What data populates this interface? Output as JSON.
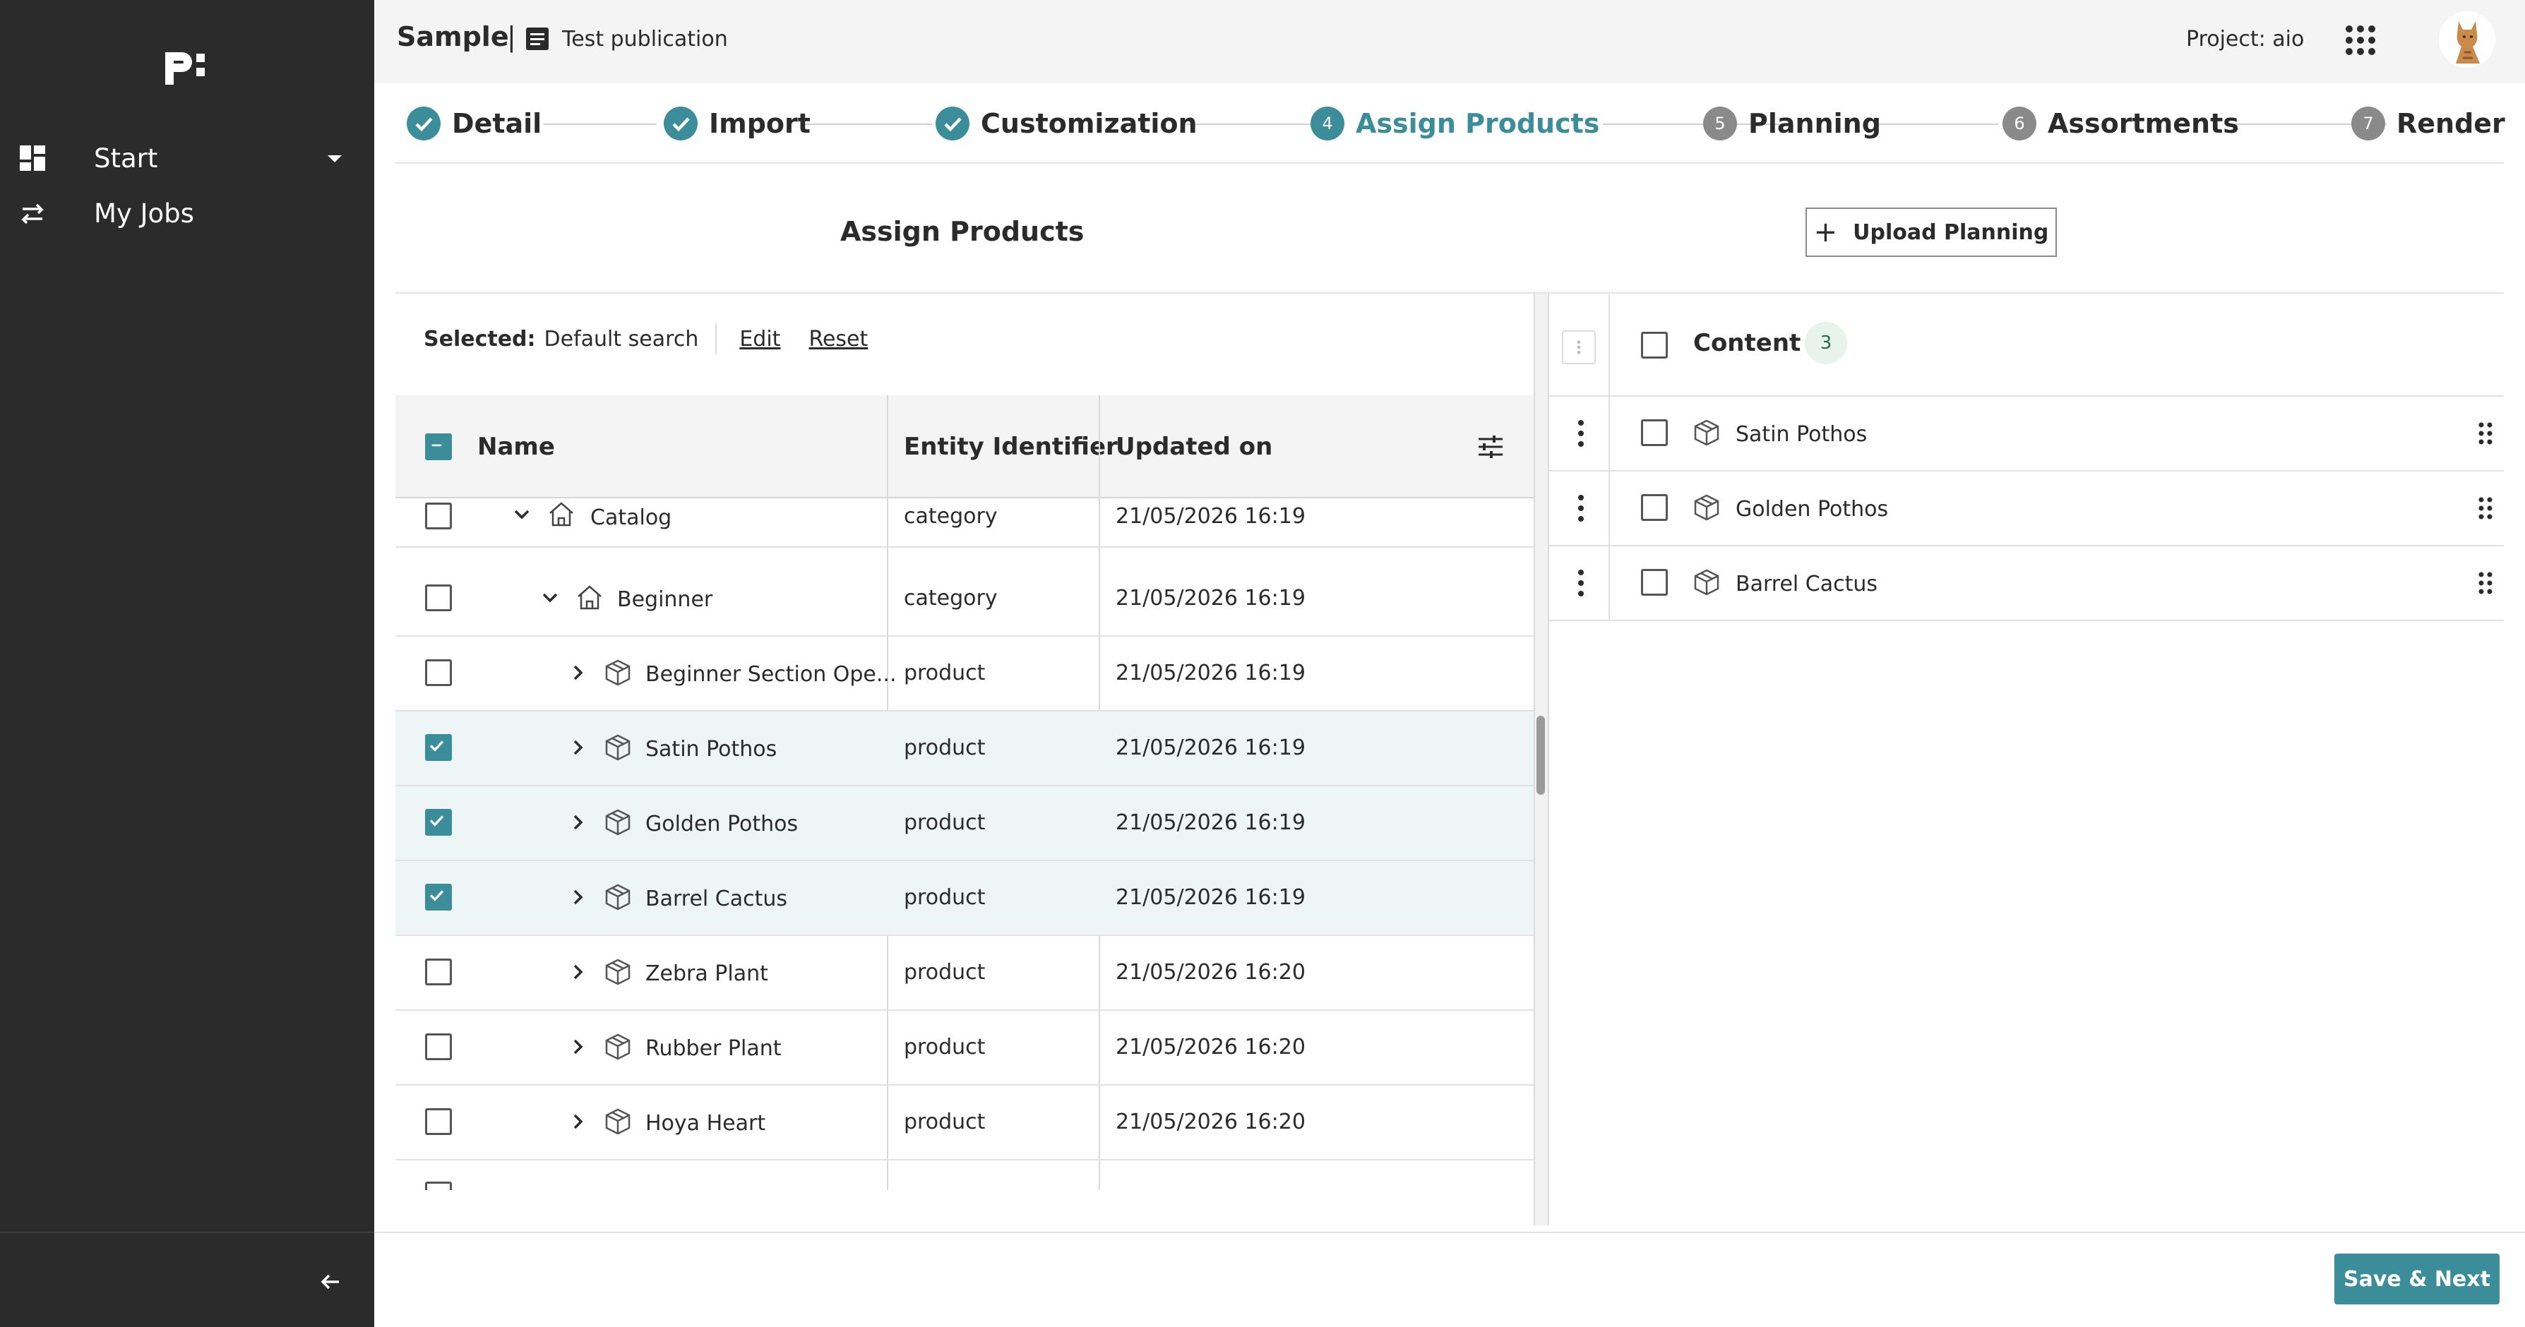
{
  "sidebar": {
    "logo_text": "p:",
    "items": [
      {
        "label": "Start",
        "icon": "dashboard-icon"
      },
      {
        "label": "My Jobs",
        "icon": "swap-icon"
      }
    ]
  },
  "header": {
    "title": "Sample",
    "separator": "|",
    "publication": "Test publication",
    "project": "Project: aio"
  },
  "stepper": {
    "steps": [
      {
        "label": "Detail",
        "state": "done"
      },
      {
        "label": "Import",
        "state": "done"
      },
      {
        "label": "Customization",
        "state": "done"
      },
      {
        "label": "Assign Products",
        "state": "active",
        "number": "4"
      },
      {
        "label": "Planning",
        "state": "todo",
        "number": "5"
      },
      {
        "label": "Assortments",
        "state": "todo",
        "number": "6"
      },
      {
        "label": "Render",
        "state": "todo",
        "number": "7"
      }
    ]
  },
  "section": {
    "title": "Assign Products",
    "upload_label": "Upload Planning"
  },
  "selection": {
    "key": "Selected:",
    "value": "Default search",
    "edit": "Edit",
    "reset": "Reset"
  },
  "table": {
    "columns": [
      "Name",
      "Entity Identifier",
      "Updated on"
    ],
    "rows": [
      {
        "name": "Catalog",
        "type": "category",
        "updated": "21/05/2026 16:19",
        "checked": false
      },
      {
        "name": "Beginner",
        "type": "category",
        "updated": "21/05/2026 16:19",
        "checked": false
      },
      {
        "name": "Beginner Section Ope...",
        "type": "product",
        "updated": "21/05/2026 16:19",
        "checked": false
      },
      {
        "name": "Satin Pothos",
        "type": "product",
        "updated": "21/05/2026 16:19",
        "checked": true
      },
      {
        "name": "Golden Pothos",
        "type": "product",
        "updated": "21/05/2026 16:19",
        "checked": true
      },
      {
        "name": "Barrel Cactus",
        "type": "product",
        "updated": "21/05/2026 16:19",
        "checked": true
      },
      {
        "name": "Zebra Plant",
        "type": "product",
        "updated": "21/05/2026 16:20",
        "checked": false
      },
      {
        "name": "Rubber Plant",
        "type": "product",
        "updated": "21/05/2026 16:20",
        "checked": false
      },
      {
        "name": "Hoya Heart",
        "type": "product",
        "updated": "21/05/2026 16:20",
        "checked": false
      }
    ]
  },
  "content": {
    "title": "Content",
    "count": "3",
    "items": [
      "Satin Pothos",
      "Golden Pothos",
      "Barrel Cactus"
    ]
  },
  "footer": {
    "save_label": "Save & Next"
  },
  "colors": {
    "accent": "#3b8d99",
    "sidebar": "#2b2b2b"
  }
}
